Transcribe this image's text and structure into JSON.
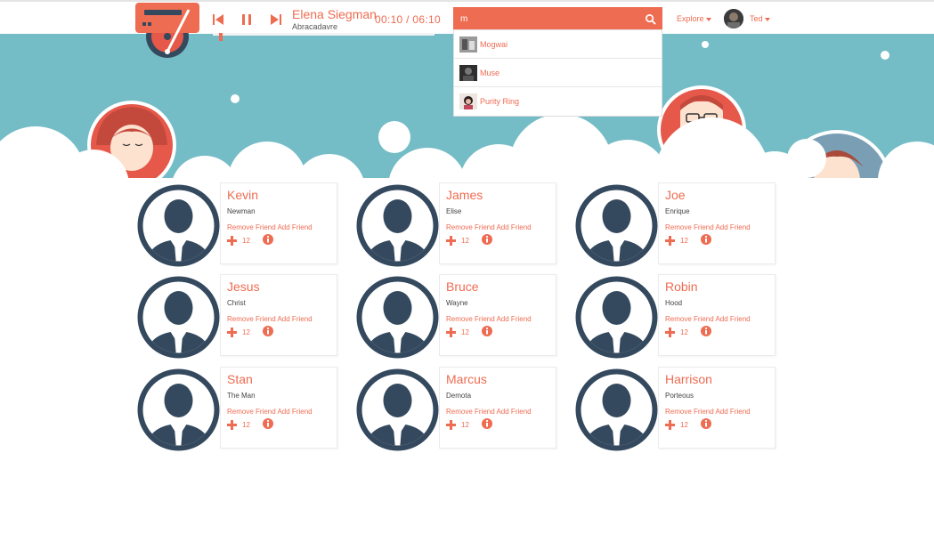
{
  "player": {
    "track_title": "Elena Siegman",
    "track_artist": "Abracadavre",
    "time": "00:10 / 06:10",
    "progress_fraction": 0.027
  },
  "search": {
    "value": "m",
    "results": [
      {
        "label": "Mogwai",
        "thumb_color": "#8a8a8a"
      },
      {
        "label": "Muse",
        "thumb_color": "#2e2e2e"
      },
      {
        "label": "Purity Ring",
        "thumb_color": "#c0485a"
      }
    ]
  },
  "nav": {
    "explore_label": "Explore",
    "user_name": "Ted"
  },
  "card_labels": {
    "remove": "Remove Friend",
    "add": "Add Friend"
  },
  "friends": [
    {
      "first": "Kevin",
      "last": "Newman",
      "count": "12"
    },
    {
      "first": "James",
      "last": "Elise",
      "count": "12"
    },
    {
      "first": "Joe",
      "last": "Enrique",
      "count": "12"
    },
    {
      "first": "Jesus",
      "last": "Christ",
      "count": "12"
    },
    {
      "first": "Bruce",
      "last": "Wayne",
      "count": "12"
    },
    {
      "first": "Robin",
      "last": "Hood",
      "count": "12"
    },
    {
      "first": "Stan",
      "last": "The Man",
      "count": "12"
    },
    {
      "first": "Marcus",
      "last": "Demota",
      "count": "12"
    },
    {
      "first": "Harrison",
      "last": "Porteous",
      "count": "12"
    }
  ],
  "colors": {
    "accent": "#ee6c52",
    "sky": "#74bcc6",
    "avatar_dark": "#34495e"
  }
}
